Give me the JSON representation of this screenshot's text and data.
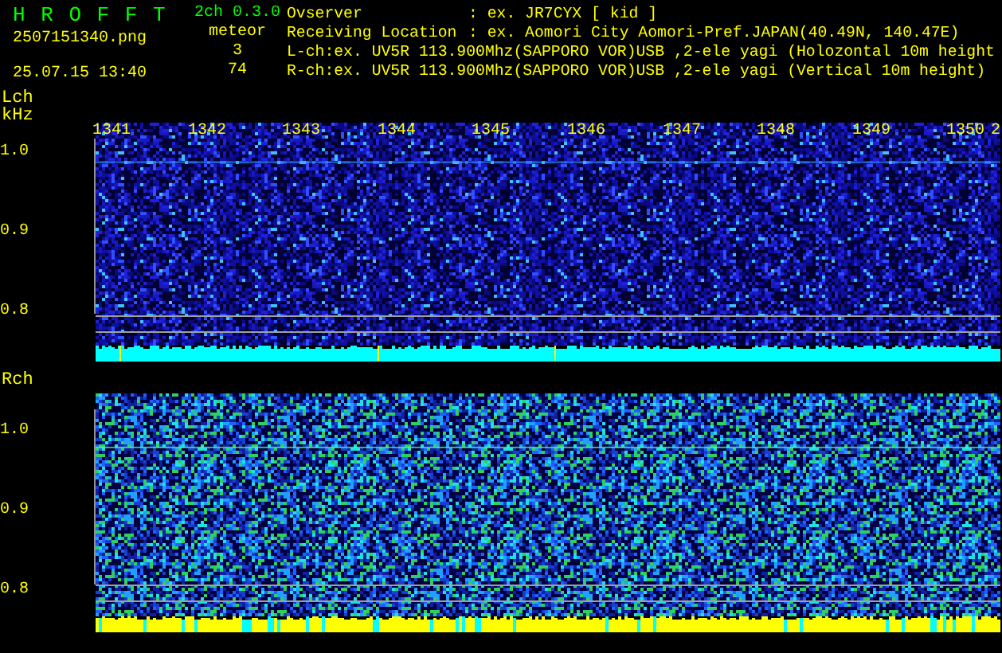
{
  "header": {
    "title": "H R O F F T",
    "version": "2ch 0.3.0",
    "filename": "2507151340.png",
    "timestamp": "25.07.15 13:40",
    "meteor_label": "meteor",
    "counts": [
      "3",
      "74"
    ],
    "info": [
      {
        "label": "Ovserver",
        "value": ": ex. JR7CYX [ kid ]"
      },
      {
        "label": "Receiving Location",
        "value": ": ex. Aomori City Aomori-Pref.JAPAN(40.49N, 140.47E)"
      }
    ],
    "channel_lines": [
      "L-ch:ex. UV5R 113.900Mhz(SAPPORO VOR)USB ,2-ele yagi (Holozontal 10m height",
      "R-ch:ex. UV5R 113.900Mhz(SAPPORO VOR)USB ,2-ele yagi (Vertical 10m height)"
    ]
  },
  "frequency_ticks": [
    "1341",
    "1342",
    "1343",
    "1344",
    "1345",
    "1346",
    "1347",
    "1348",
    "1349",
    "1350",
    "2"
  ],
  "panels": [
    {
      "label": "Lch",
      "unit": "kHz",
      "y_labels": [
        "1.0",
        "0.9",
        "0.8"
      ]
    },
    {
      "label": "Rch",
      "y_labels": [
        "1.0",
        "0.9",
        "0.8"
      ]
    }
  ]
}
